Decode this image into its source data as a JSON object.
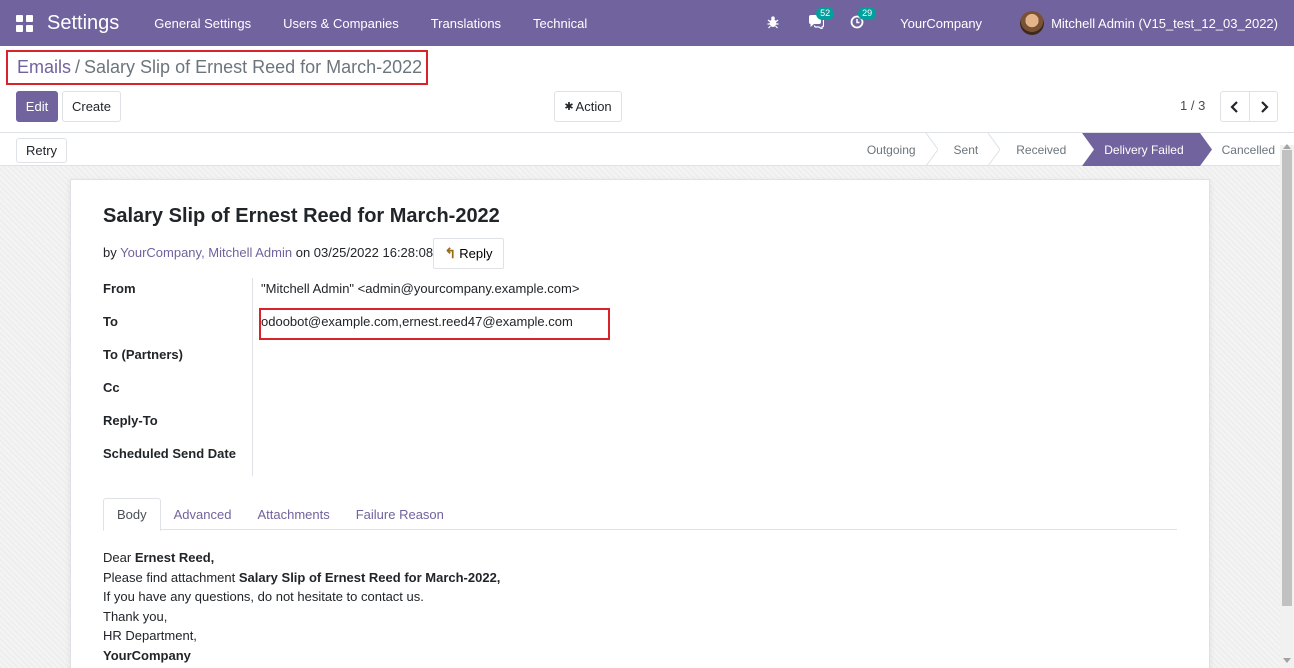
{
  "navbar": {
    "app_title": "Settings",
    "menus": [
      "General Settings",
      "Users & Companies",
      "Translations",
      "Technical"
    ],
    "messages_count": "52",
    "activities_count": "29",
    "company": "YourCompany",
    "user": "Mitchell Admin (V15_test_12_03_2022)"
  },
  "breadcrumb": {
    "parent": "Emails",
    "separator": "/",
    "current": "Salary Slip of Ernest Reed for March-2022"
  },
  "controls": {
    "edit": "Edit",
    "create": "Create",
    "action": "Action",
    "pager": "1 / 3"
  },
  "statusbar": {
    "retry": "Retry",
    "steps": [
      "Outgoing",
      "Sent",
      "Received",
      "Delivery Failed",
      "Cancelled"
    ],
    "active_step": "Delivery Failed"
  },
  "mail": {
    "subject": "Salary Slip of Ernest Reed for March-2022",
    "by_prefix": "by",
    "author": "YourCompany, Mitchell Admin",
    "on_text": "on 03/25/2022 16:28:08",
    "reply": "Reply",
    "fields": {
      "from_label": "From",
      "from_value": "\"Mitchell Admin\" <admin@yourcompany.example.com>",
      "to_label": "To",
      "to_value": "odoobot@example.com,ernest.reed47@example.com",
      "to_partners_label": "To (Partners)",
      "cc_label": "Cc",
      "reply_to_label": "Reply-To",
      "scheduled_label": "Scheduled Send Date"
    },
    "tabs": [
      "Body",
      "Advanced",
      "Attachments",
      "Failure Reason"
    ],
    "body": {
      "dear": "Dear",
      "name": "Ernest Reed,",
      "line2_prefix": "Please find attachment",
      "line2_bold": "Salary Slip of Ernest Reed for March-2022,",
      "line3": "If you have any questions, do not hesitate to contact us.",
      "line4": "Thank you,",
      "line5": "HR Department,",
      "line6": "YourCompany"
    }
  },
  "colors": {
    "brand": "#71639e",
    "highlight_border": "#d9232b",
    "badge": "#00a09d"
  }
}
